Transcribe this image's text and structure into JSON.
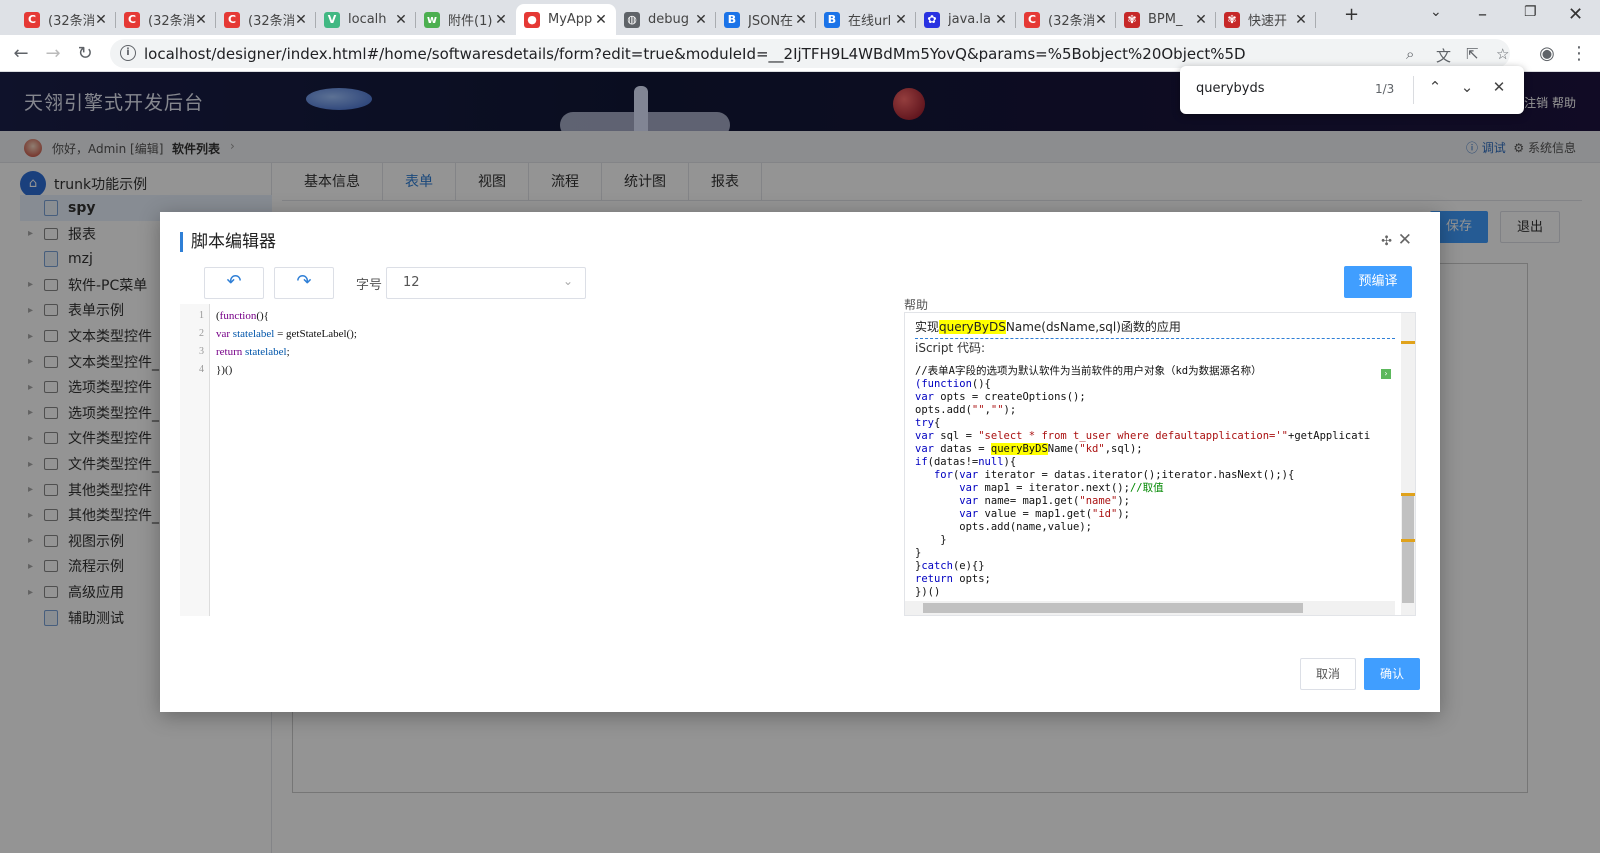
{
  "browser": {
    "tabs": [
      {
        "title": "(32条消",
        "fav": "C",
        "color": "#e53935"
      },
      {
        "title": "(32条消",
        "fav": "C",
        "color": "#e53935"
      },
      {
        "title": "(32条消",
        "fav": "C",
        "color": "#e53935"
      },
      {
        "title": "localh",
        "fav": "V",
        "color": "#41b883"
      },
      {
        "title": "附件(1)",
        "fav": "w",
        "color": "#4caf50"
      },
      {
        "title": "MyApp",
        "fav": "●",
        "color": "#e53935"
      },
      {
        "title": "debug",
        "fav": "◍",
        "color": "#5f6368"
      },
      {
        "title": "JSON在",
        "fav": "B",
        "color": "#1a73e8"
      },
      {
        "title": "在线url",
        "fav": "B",
        "color": "#1a73e8"
      },
      {
        "title": "java.la",
        "fav": "✿",
        "color": "#2932e1"
      },
      {
        "title": "(32条消",
        "fav": "C",
        "color": "#e53935"
      },
      {
        "title": "BPM_",
        "fav": "✾",
        "color": "#c62828"
      },
      {
        "title": "快速开",
        "fav": "✾",
        "color": "#c62828"
      }
    ],
    "new_tab": "+",
    "url": "localhost/designer/index.html#/home/softwaresdetails/form?edit=true&moduleId=__2IjTFH9L4WBdMm5YovQ&params=%5Bobject%20Object%5D"
  },
  "findbar": {
    "query": "querybyds",
    "count": "1/3"
  },
  "app": {
    "title": "天翎引擎式开发后台",
    "top_links": "注销  帮助",
    "greeting": "你好，Admin [编辑]",
    "breadcrumb": "软件列表",
    "debug": "ⓘ 调试",
    "sysinfo": "⚙ 系统信息"
  },
  "sidebar": {
    "root": "trunk功能示例",
    "items": [
      {
        "label": "spy",
        "type": "doc",
        "expand": false
      },
      {
        "label": "报表",
        "type": "folder",
        "expand": true
      },
      {
        "label": "mzj",
        "type": "doc",
        "expand": false
      },
      {
        "label": "软件-PC菜单",
        "type": "folder",
        "expand": true
      },
      {
        "label": "表单示例",
        "type": "folder",
        "expand": true
      },
      {
        "label": "文本类型控件",
        "type": "folder",
        "expand": true
      },
      {
        "label": "文本类型控件_",
        "type": "folder",
        "expand": true
      },
      {
        "label": "选项类型控件",
        "type": "folder",
        "expand": true
      },
      {
        "label": "选项类型控件_",
        "type": "folder",
        "expand": true
      },
      {
        "label": "文件类型控件",
        "type": "folder",
        "expand": true
      },
      {
        "label": "文件类型控件_",
        "type": "folder",
        "expand": true
      },
      {
        "label": "其他类型控件",
        "type": "folder",
        "expand": true
      },
      {
        "label": "其他类型控件_",
        "type": "folder",
        "expand": true
      },
      {
        "label": "视图示例",
        "type": "folder",
        "expand": true
      },
      {
        "label": "流程示例",
        "type": "folder",
        "expand": true
      },
      {
        "label": "高级应用",
        "type": "folder",
        "expand": true
      },
      {
        "label": "辅助测试",
        "type": "doc",
        "expand": false
      }
    ]
  },
  "main": {
    "tabs": [
      "基本信息",
      "表单",
      "视图",
      "流程",
      "统计图",
      "报表"
    ],
    "active_tab": 1,
    "save": "保存",
    "exit": "退出"
  },
  "dialog": {
    "title": "脚本编辑器",
    "font_size_label": "字号",
    "font_size_value": "12",
    "precompile": "预编译",
    "help_label": "帮助",
    "code_lines": [
      "(function(){",
      "var statelabel = getStateLabel();",
      "return statelabel;",
      "})()"
    ],
    "help_heading_pre": "实现",
    "help_heading_hl": "queryByDS",
    "help_heading_post": "Name(dsName,sql)函数的应用",
    "help_sub": "iScript 代码:",
    "help_comment": "//表单A字段的选项为默认软件为当前软件的用户对象（kd为数据源名称）",
    "cancel": "取消",
    "confirm": "确认"
  }
}
